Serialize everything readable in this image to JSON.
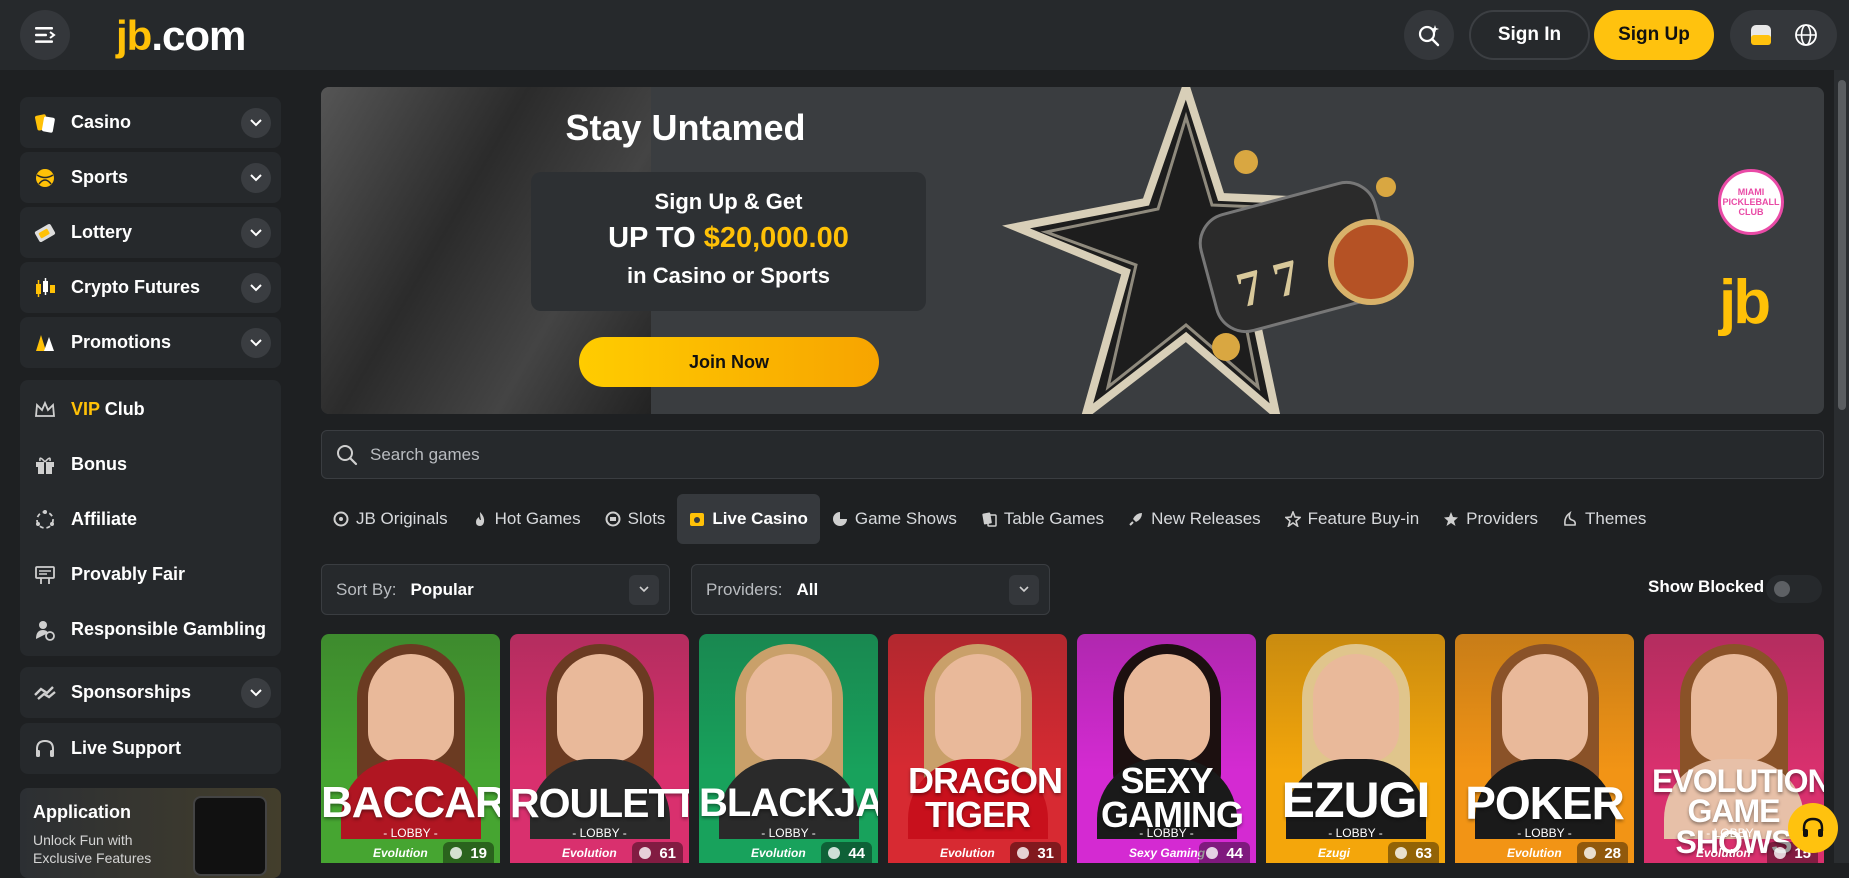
{
  "header": {
    "logo_jb": "jb",
    "logo_com": ".com",
    "signin_label": "Sign In",
    "signup_label": "Sign Up"
  },
  "sidebar": {
    "main": [
      {
        "label": "Casino",
        "icon": "casino-icon"
      },
      {
        "label": "Sports",
        "icon": "sports-icon"
      },
      {
        "label": "Lottery",
        "icon": "lottery-icon"
      },
      {
        "label": "Crypto Futures",
        "icon": "crypto-futures-icon"
      },
      {
        "label": "Promotions",
        "icon": "promotions-icon"
      }
    ],
    "vip_word": "VIP",
    "vip_rest": " Club",
    "extras": [
      {
        "label": "Bonus",
        "icon": "gift-icon"
      },
      {
        "label": "Affiliate",
        "icon": "affiliate-icon"
      },
      {
        "label": "Provably Fair",
        "icon": "provably-fair-icon"
      },
      {
        "label": "Responsible Gambling",
        "icon": "responsible-gambling-icon"
      }
    ],
    "sponsorships": "Sponsorships",
    "live_support": "Live Support",
    "app": {
      "title": "Application",
      "subtitle": "Unlock Fun with Exclusive Features"
    }
  },
  "banner": {
    "title": "Stay Untamed",
    "line1": "Sign Up & Get",
    "line2_prefix": "UP TO ",
    "line2_amount": "$20,000.00",
    "line3": "in Casino or Sports",
    "join_label": "Join Now",
    "badge": "MIAMI PICKLEBALL CLUB",
    "brand": "jb"
  },
  "search": {
    "placeholder": "Search games"
  },
  "categories": [
    {
      "label": "JB Originals",
      "icon": "jb-originals-icon"
    },
    {
      "label": "Hot Games",
      "icon": "fire-icon"
    },
    {
      "label": "Slots",
      "icon": "slots-icon"
    },
    {
      "label": "Live Casino",
      "icon": "live-casino-icon"
    },
    {
      "label": "Game Shows",
      "icon": "game-shows-icon"
    },
    {
      "label": "Table Games",
      "icon": "table-games-icon"
    },
    {
      "label": "New Releases",
      "icon": "rocket-icon"
    },
    {
      "label": "Feature Buy-in",
      "icon": "star-icon"
    },
    {
      "label": "Providers",
      "icon": "providers-icon"
    },
    {
      "label": "Themes",
      "icon": "themes-icon"
    }
  ],
  "active_category": "Live Casino",
  "filters": {
    "sort_key": "Sort By:",
    "sort_value": "Popular",
    "providers_key": "Providers:",
    "providers_value": "All",
    "show_blocked": "Show Blocked"
  },
  "games": [
    {
      "name": "BACCARAT",
      "lobby": "- LOBBY -",
      "provider": "Evolution",
      "count": "19",
      "color": "#46a531"
    },
    {
      "name": "ROULETTE",
      "lobby": "- LOBBY -",
      "provider": "Evolution",
      "count": "61",
      "color": "#d9306e"
    },
    {
      "name": "BLACKJACK",
      "lobby": "- LOBBY -",
      "provider": "Evolution",
      "count": "44",
      "color": "#18a25c"
    },
    {
      "name": "DRAGON TIGER",
      "lobby": "",
      "provider": "Evolution",
      "count": "31",
      "color": "#d72a32"
    },
    {
      "name": "SEXY GAMING",
      "lobby": "- LOBBY -",
      "provider": "Sexy Gaming",
      "count": "44",
      "color": "#d42ad2"
    },
    {
      "name": "EZUGI",
      "lobby": "- LOBBY -",
      "provider": "Ezugi",
      "count": "63",
      "color": "#f4a60b"
    },
    {
      "name": "POKER",
      "lobby": "- LOBBY -",
      "provider": "Evolution",
      "count": "28",
      "color": "#f29415"
    },
    {
      "name": "EVOLUTION GAME SHOWS",
      "lobby": "- LOBBY -",
      "provider": "Evolution",
      "count": "15",
      "color": "#d9306e"
    }
  ],
  "colors": {
    "accent": "#ffc20e",
    "background": "#1e2022",
    "panel": "#26292c"
  }
}
